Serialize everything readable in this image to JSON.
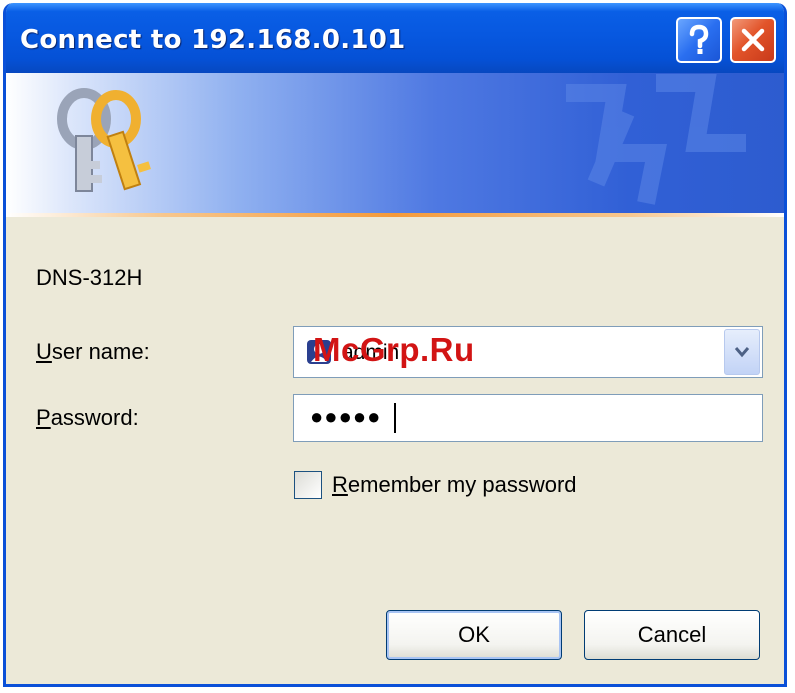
{
  "window": {
    "title": "Connect to 192.168.0.101",
    "help_icon": "question-mark-icon",
    "close_icon": "close-x-icon"
  },
  "banner": {
    "icon": "keys-icon"
  },
  "form": {
    "device_name": "DNS-312H",
    "user_label_prefix": "U",
    "user_label_rest": "ser name:",
    "user_value": "admin",
    "password_label_prefix": "P",
    "password_label_rest": "assword:",
    "password_value": "●●●●●",
    "remember_prefix": "R",
    "remember_rest": "emember my password",
    "remember_checked": false
  },
  "buttons": {
    "ok": "OK",
    "cancel": "Cancel"
  },
  "watermark": "McGrp.Ru",
  "colors": {
    "titlebar": "#0758e0",
    "dialog_bg": "#ece9d8",
    "close_red": "#e2542a",
    "accent_orange": "#f49a3a",
    "watermark_red": "#d21414"
  }
}
